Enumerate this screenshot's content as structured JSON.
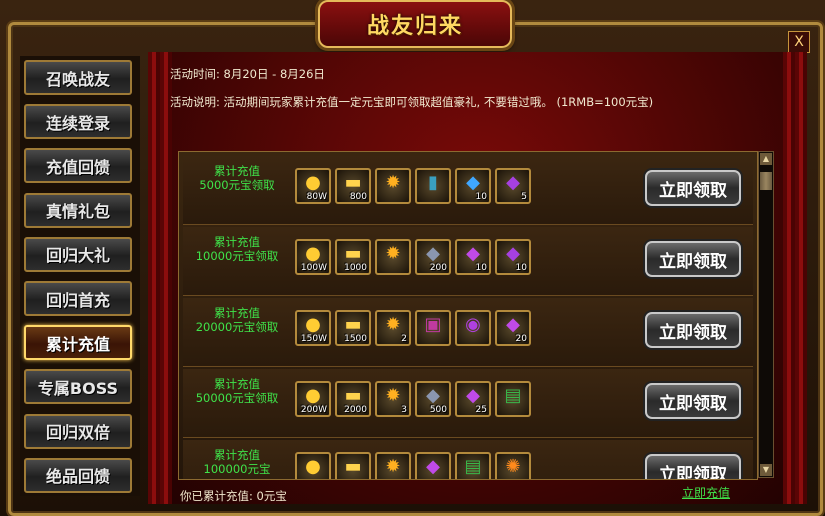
{
  "window": {
    "title": "战友归来",
    "close_label": "X"
  },
  "sidebar": {
    "items": [
      {
        "label": "召唤战友",
        "active": false
      },
      {
        "label": "连续登录",
        "active": false
      },
      {
        "label": "充值回馈",
        "active": false
      },
      {
        "label": "真情礼包",
        "active": false
      },
      {
        "label": "回归大礼",
        "active": false
      },
      {
        "label": "回归首充",
        "active": false
      },
      {
        "label": "累计充值",
        "active": true
      },
      {
        "label": "专属BOSS",
        "active": false
      },
      {
        "label": "回归双倍",
        "active": false
      },
      {
        "label": "绝品回馈",
        "active": false
      }
    ]
  },
  "main": {
    "activity_time": "活动时间: 8月20日 - 8月26日",
    "activity_desc": "活动说明: 活动期间玩家累计充值一定元宝即可领取超值豪礼, 不要错过哦。 (1RMB=100元宝)",
    "claim_label": "立即领取",
    "rows": [
      {
        "label": "累计充值\n5000元宝领取",
        "items": [
          {
            "icon": "gold-pile-icon",
            "count": "80W"
          },
          {
            "icon": "gold-ingot-icon",
            "count": "800"
          },
          {
            "icon": "gold-medal-icon",
            "count": ""
          },
          {
            "icon": "skill-book-icon",
            "count": ""
          },
          {
            "icon": "blue-gem-icon",
            "count": "10"
          },
          {
            "icon": "purple-crystal-icon",
            "count": "5"
          }
        ]
      },
      {
        "label": "累计充值\n10000元宝领取",
        "items": [
          {
            "icon": "gold-pile-icon",
            "count": "100W"
          },
          {
            "icon": "gold-ingot-icon",
            "count": "1000"
          },
          {
            "icon": "gold-medal-icon",
            "count": ""
          },
          {
            "icon": "iron-ore-icon",
            "count": "200"
          },
          {
            "icon": "purple-shard-icon",
            "count": "10"
          },
          {
            "icon": "purple-crystal-icon",
            "count": "10"
          }
        ]
      },
      {
        "label": "累计充值\n20000元宝领取",
        "items": [
          {
            "icon": "gold-pile-icon",
            "count": "150W"
          },
          {
            "icon": "gold-ingot-icon",
            "count": "1500"
          },
          {
            "icon": "gold-medal-icon",
            "count": "2"
          },
          {
            "icon": "purple-armor-icon",
            "count": ""
          },
          {
            "icon": "purple-rune-icon",
            "count": ""
          },
          {
            "icon": "purple-shard-icon",
            "count": "20"
          }
        ]
      },
      {
        "label": "累计充值\n50000元宝领取",
        "items": [
          {
            "icon": "gold-pile-icon",
            "count": "200W"
          },
          {
            "icon": "gold-ingot-icon",
            "count": "2000"
          },
          {
            "icon": "gold-medal-icon",
            "count": "3"
          },
          {
            "icon": "iron-ore-icon",
            "count": "500"
          },
          {
            "icon": "purple-shard-icon",
            "count": "25"
          },
          {
            "icon": "treasure-chest-icon",
            "count": ""
          }
        ]
      },
      {
        "label": "累计充值\n100000元宝",
        "items": [
          {
            "icon": "gold-pile-icon",
            "count": ""
          },
          {
            "icon": "gold-ingot-icon",
            "count": ""
          },
          {
            "icon": "gold-medal-icon",
            "count": ""
          },
          {
            "icon": "purple-shard-icon",
            "count": ""
          },
          {
            "icon": "treasure-chest-icon",
            "count": ""
          },
          {
            "icon": "orange-orb-icon",
            "count": ""
          }
        ]
      }
    ],
    "footer_text": "你已累计充值: 0元宝",
    "recharge_link": "立即充值"
  }
}
